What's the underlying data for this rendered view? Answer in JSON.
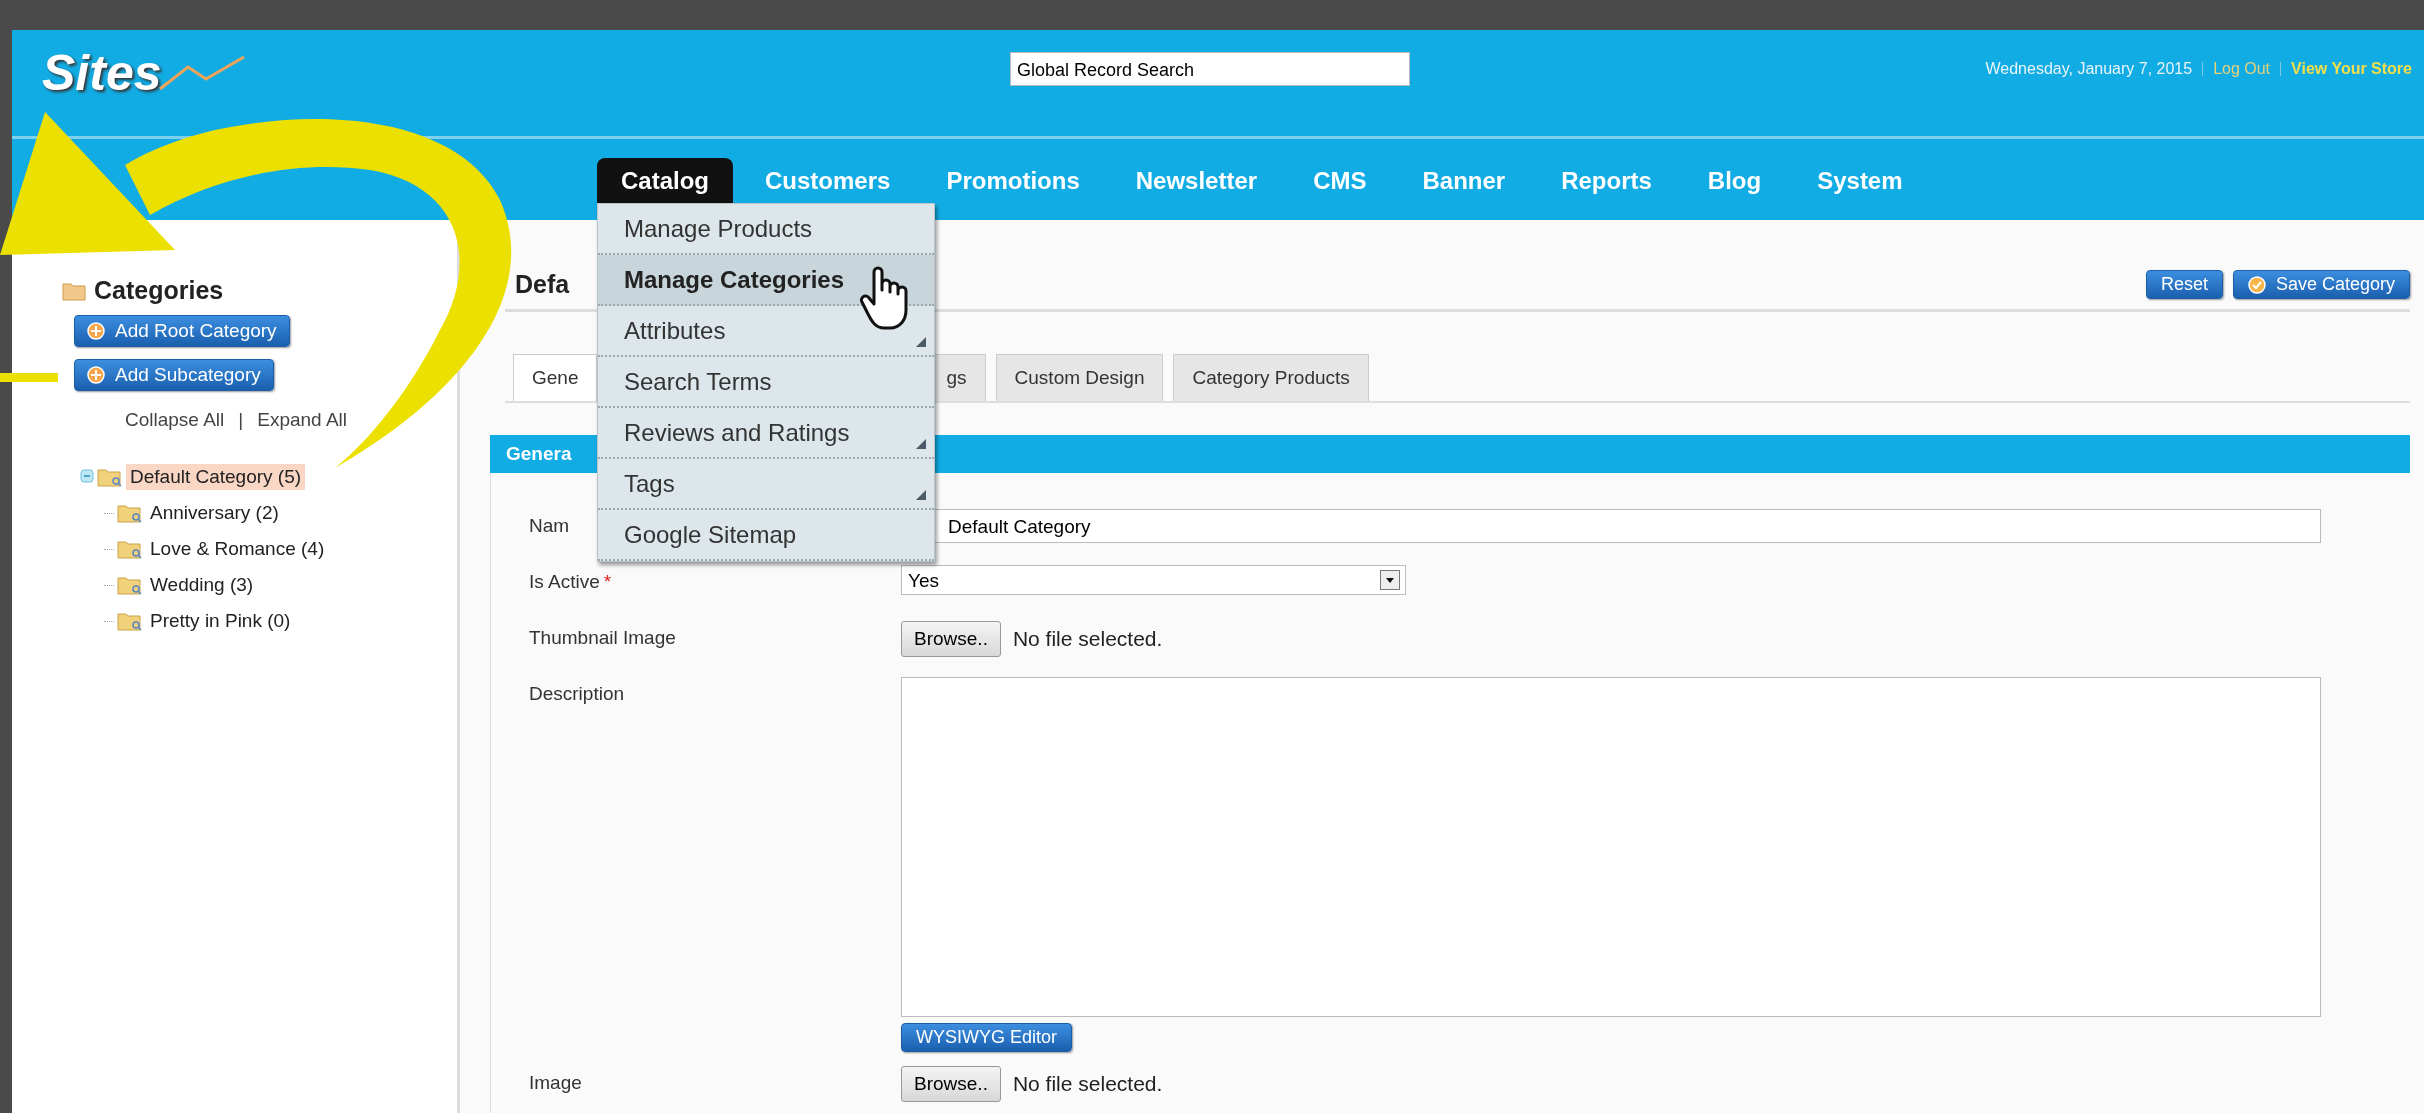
{
  "header": {
    "logo": "Sites",
    "search": {
      "value": "Global Record Search"
    },
    "date": "Wednesday, January 7, 2015",
    "links": [
      {
        "label": "Log Out",
        "kind": "plain"
      },
      {
        "label": "View Your Store",
        "kind": "strong"
      }
    ]
  },
  "nav": [
    {
      "label": "Catalog",
      "selected": true
    },
    {
      "label": "Customers",
      "selected": false
    },
    {
      "label": "Promotions",
      "selected": false
    },
    {
      "label": "Newsletter",
      "selected": false
    },
    {
      "label": "CMS",
      "selected": false
    },
    {
      "label": "Banner",
      "selected": false
    },
    {
      "label": "Reports",
      "selected": false
    },
    {
      "label": "Blog",
      "selected": false
    },
    {
      "label": "System",
      "selected": false
    }
  ],
  "menu": [
    {
      "label": "Manage Products",
      "selected": false,
      "submenu": false
    },
    {
      "label": "Manage Categories",
      "selected": true,
      "submenu": false
    },
    {
      "label": "Attributes",
      "selected": false,
      "submenu": true
    },
    {
      "label": "Search Terms",
      "selected": false,
      "submenu": false
    },
    {
      "label": "Reviews and Ratings",
      "selected": false,
      "submenu": true
    },
    {
      "label": "Tags",
      "selected": false,
      "submenu": true
    },
    {
      "label": "Google Sitemap",
      "selected": false,
      "submenu": false
    }
  ],
  "sidebar": {
    "title": "Categories",
    "buttons": [
      "Add Root Category",
      "Add Subcategory"
    ],
    "collapse": "Collapse All",
    "separator": "|",
    "expand": "Expand All",
    "tree": [
      {
        "label": "Default Category (5)",
        "selected": true,
        "expanded": true,
        "children": [
          {
            "label": "Anniversary (2)",
            "selected": false
          },
          {
            "label": "Love & Romance (4)",
            "selected": false
          },
          {
            "label": "Wedding (3)",
            "selected": false
          },
          {
            "label": "Pretty in Pink (0)",
            "selected": false
          }
        ]
      }
    ]
  },
  "page": {
    "title": "Defa",
    "actions": [
      {
        "label": "Reset",
        "kind": "plain"
      },
      {
        "label": "Save Category",
        "kind": "save"
      }
    ],
    "tabs": [
      {
        "label": "Gene",
        "selected": true
      },
      {
        "label": "gs",
        "selected": false
      },
      {
        "label": "Custom Design",
        "selected": false
      },
      {
        "label": "Category Products",
        "selected": false
      }
    ],
    "section": "Genera",
    "required_mark": "*",
    "fields": [
      {
        "kind": "text",
        "label": "Nam",
        "required": false,
        "value": "Default Category"
      },
      {
        "kind": "select",
        "label": "Is Active",
        "required": true,
        "value": "Yes"
      },
      {
        "kind": "file",
        "label": "Thumbnail Image",
        "required": false,
        "button": "Browse..",
        "status": "No file selected."
      },
      {
        "kind": "textarea",
        "label": "Description",
        "required": false,
        "button": "WYSIWYG Editor"
      },
      {
        "kind": "file",
        "label": "Image",
        "required": false,
        "button": "Browse..",
        "status": "No file selected."
      }
    ]
  }
}
